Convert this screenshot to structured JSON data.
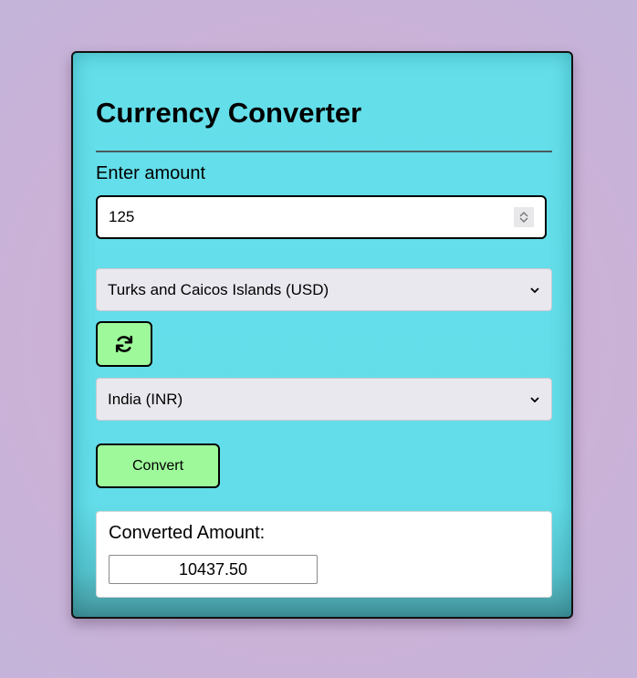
{
  "app": {
    "title": "Currency Converter"
  },
  "amount": {
    "label": "Enter amount",
    "value": "125"
  },
  "from_currency": {
    "selected": "Turks and Caicos Islands (USD)"
  },
  "swap": {
    "icon": "refresh-icon"
  },
  "to_currency": {
    "selected": "India (INR)"
  },
  "convert": {
    "label": "Convert"
  },
  "result": {
    "label": "Converted Amount:",
    "value": "10437.50"
  },
  "colors": {
    "card_background": "#64dfea",
    "button_background": "#9ef99a",
    "select_background": "#e9e8ee"
  }
}
